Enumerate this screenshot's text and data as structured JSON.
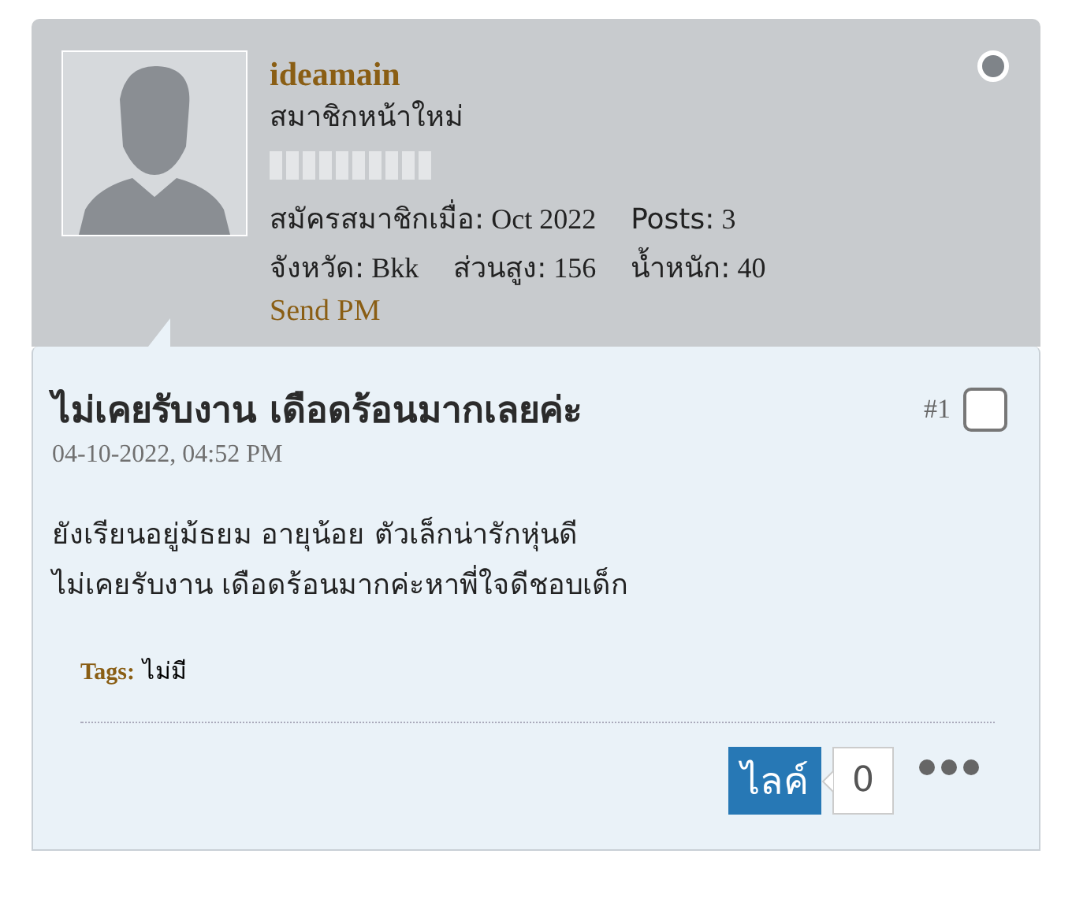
{
  "user": {
    "name": "ideamain",
    "rank": "สมาชิกหน้าใหม่",
    "online": false,
    "stats_rows": [
      [
        {
          "label": "สมัครสมาชิกเมื่อ:",
          "value": "Oct 2022"
        },
        {
          "label": "Posts:",
          "value": "3"
        }
      ],
      [
        {
          "label": "จังหวัด:",
          "value": "Bkk"
        },
        {
          "label": "ส่วนสูง:",
          "value": "156"
        },
        {
          "label": "น้ำหนัก:",
          "value": "40"
        }
      ]
    ],
    "send_pm": "Send PM"
  },
  "post": {
    "title": "ไม่เคยรับงาน เดือดร้อนมากเลยค่ะ",
    "number": "#1",
    "checked": false,
    "date": "04-10-2022, 04:52 PM",
    "body": [
      "ยังเรียนอยู่ม้ธยม อายุน้อย ตัวเล็กน่ารักหุ่นดี",
      "ไม่เคยรับงาน เดือดร้อนมากค่ะหาพี่ใจดีชอบเด็ก"
    ],
    "tags_label": "Tags:",
    "tags_value": "ไม่มี",
    "like_label": "ไลค์",
    "like_count": "0"
  }
}
